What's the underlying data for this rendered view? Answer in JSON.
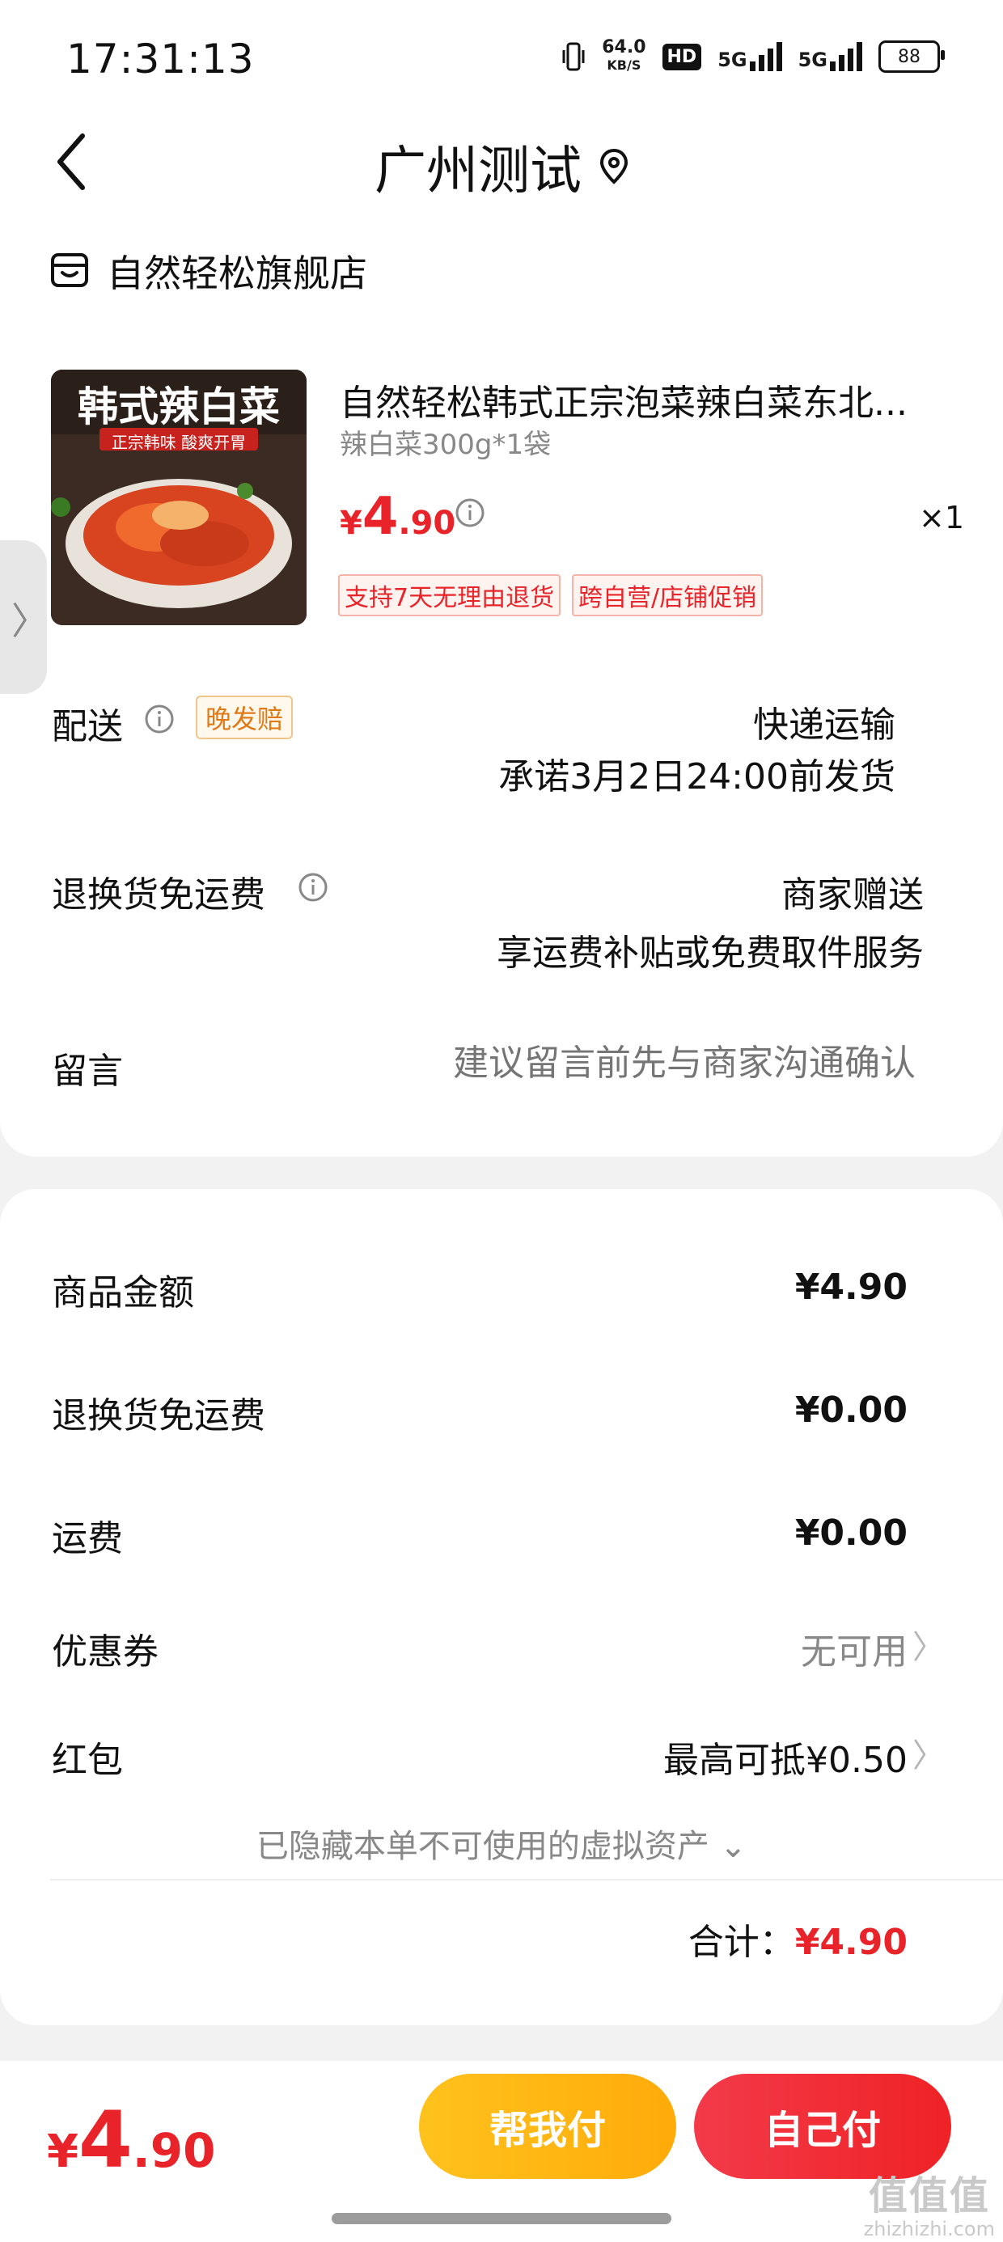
{
  "status_bar": {
    "time": "17:31:13",
    "net_speed_value": "64.0",
    "net_speed_unit": "KB/S",
    "hd_label": "HD",
    "signal1": "5G",
    "signal2": "5G",
    "battery": "88"
  },
  "header": {
    "title": "广州测试",
    "icon": "location-icon"
  },
  "store": {
    "name": "自然轻松旗舰店"
  },
  "product": {
    "image_text": "韩式辣白菜",
    "image_subtext": "正宗韩味 酸爽开胃",
    "title": "自然轻松韩式正宗泡菜辣白菜东北...",
    "spec": "辣白菜300g*1袋",
    "price_symbol": "¥",
    "price_int": "4",
    "price_dec": ".90",
    "quantity": "×1",
    "tags": [
      "支持7天无理由退货",
      "跨自营/店铺促销"
    ]
  },
  "delivery": {
    "label": "配送",
    "badge": "晚发赔",
    "method": "快递运输",
    "promise": "承诺3月2日24:00前发货"
  },
  "return_shipping": {
    "label": "退换货免运费",
    "value": "商家赠送",
    "desc": "享运费补贴或免费取件服务"
  },
  "message": {
    "label": "留言",
    "placeholder": "建议留言前先与商家沟通确认"
  },
  "fees": {
    "goods_label": "商品金额",
    "goods_value": "¥4.90",
    "return_label": "退换货免运费",
    "return_value": "¥0.00",
    "shipping_label": "运费",
    "shipping_value": "¥0.00",
    "coupon_label": "优惠券",
    "coupon_value": "无可用",
    "redpacket_label": "红包",
    "redpacket_value": "最高可抵¥0.50",
    "hidden_assets": "已隐藏本单不可使用的虚拟资产 ⌄",
    "total_label": "合计：",
    "total_value": "¥4.90"
  },
  "bottom": {
    "price_symbol": "¥",
    "price_int": "4",
    "price_dec": ".90",
    "help_pay": "帮我付",
    "self_pay": "自己付"
  },
  "watermark": {
    "main": "值值值",
    "sub": "zhizhizhi.com"
  },
  "colors": {
    "accent_red": "#e8242a",
    "help_yellow": "#ffb712",
    "badge_orange": "#e07a16"
  }
}
